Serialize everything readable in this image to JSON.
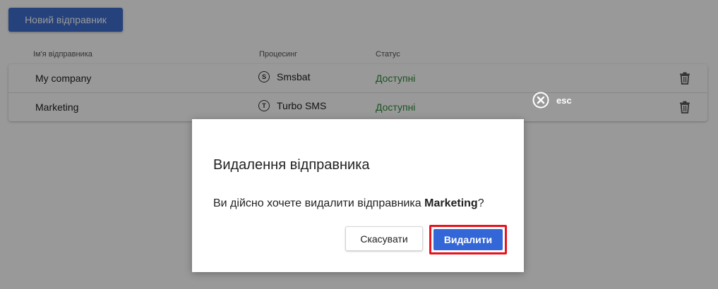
{
  "toolbar": {
    "new_sender_label": "Новий відправник"
  },
  "table": {
    "headers": {
      "name": "Ім'я відправника",
      "processing": "Процесинг",
      "status": "Статус"
    },
    "rows": [
      {
        "name": "My company",
        "processing_icon": "S",
        "processing": "Smsbat",
        "status": "Доступні"
      },
      {
        "name": "Marketing",
        "processing_icon": "T",
        "processing": "Turbo SMS",
        "status": "Доступні"
      }
    ]
  },
  "overlay": {
    "esc_label": "esc"
  },
  "dialog": {
    "title": "Видалення відправника",
    "message_prefix": "Ви дійсно хочете видалити відправника ",
    "message_target": "Marketing",
    "message_suffix": "?",
    "cancel_label": "Скасувати",
    "delete_label": "Видалити"
  },
  "colors": {
    "primary": "#3366d6",
    "status_available": "#2e8b3a",
    "highlight": "#e8131c"
  }
}
